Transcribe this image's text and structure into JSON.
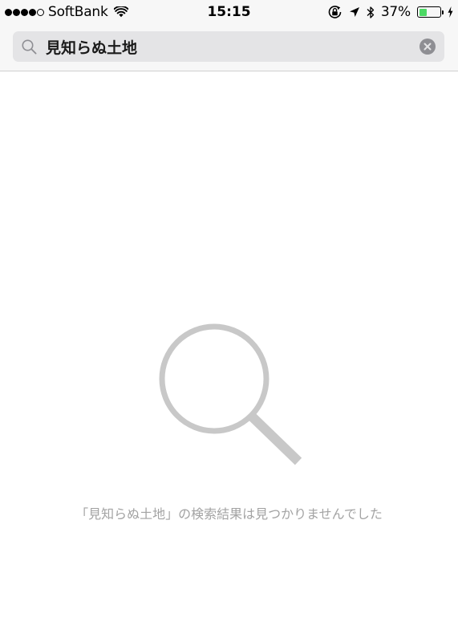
{
  "status_bar": {
    "signal_bars_filled": 4,
    "signal_bars_total": 5,
    "carrier": "SoftBank",
    "time": "15:15",
    "battery_percent": "37%",
    "battery_level": 0.37,
    "icons": [
      "wifi-icon",
      "orientation-lock-icon",
      "location-arrow-icon",
      "bluetooth-icon",
      "battery-icon",
      "charging-bolt-icon"
    ]
  },
  "search": {
    "query": "見知らぬ土地",
    "icon": "search-icon",
    "clear_icon": "clear-icon"
  },
  "empty_state": {
    "icon": "magnifier-icon",
    "message": "「見知らぬ土地」の検索結果は見つかりませんでした"
  },
  "colors": {
    "accent_battery": "#4cd964",
    "search_field": "#e4e4e6",
    "muted_text": "#a3a3a3",
    "illustration": "#c8c8c8"
  }
}
